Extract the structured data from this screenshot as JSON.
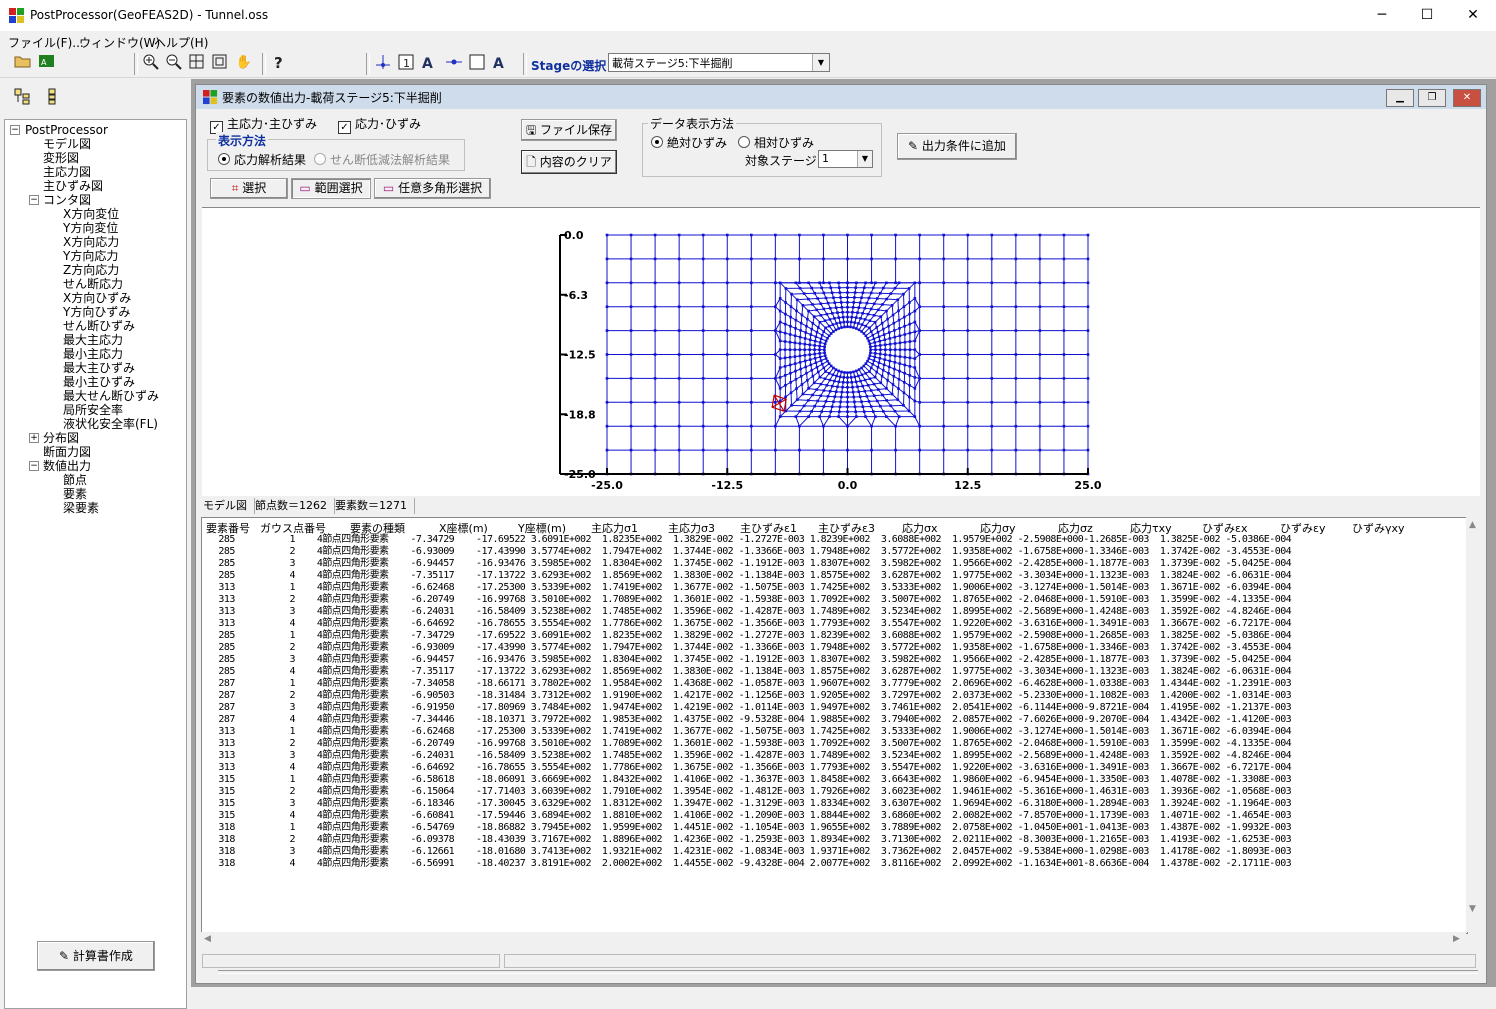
{
  "window": {
    "title": "PostProcessor(GeoFEAS2D) - Tunnel.oss",
    "minimize": "─",
    "maximize": "☐",
    "close": "✕"
  },
  "menu": [
    "ファイル(F)...",
    "ウィンドウ(W)",
    "ヘルプ(H)"
  ],
  "toolbar": {
    "stage_label": "Stageの選択",
    "stage_value": "載荷ステージ5:下半掘削"
  },
  "tree": {
    "root": "PostProcessor",
    "items": [
      "モデル図",
      "変形図",
      "主応力図",
      "主ひずみ図",
      "コンタ図",
      "X方向変位",
      "Y方向変位",
      "X方向応力",
      "Y方向応力",
      "Z方向応力",
      "せん断応力",
      "X方向ひずみ",
      "Y方向ひずみ",
      "せん断ひずみ",
      "最大主応力",
      "最小主応力",
      "最大主ひずみ",
      "最小主ひずみ",
      "最大せん断ひずみ",
      "局所安全率",
      "液状化安全率(FL)",
      "分布図",
      "断面力図",
      "数値出力",
      "節点",
      "要素",
      "梁要素"
    ]
  },
  "calc_button": "計算書作成",
  "child": {
    "title": "要素の数値出力-載荷ステージ5:下半掘削",
    "chk_principal": "主応力･主ひずみ",
    "chk_stress": "応力･ひずみ",
    "display_method": "表示方法",
    "radio_stress": "応力解析結果",
    "radio_shear": "せん断低減法解析結果",
    "btn_save": "ファイル保存",
    "btn_clear": "内容のクリア",
    "data_method": "データ表示方法",
    "radio_abs": "絶対ひずみ",
    "radio_rel": "相対ひずみ",
    "target_stage_label": "対象ステージ",
    "target_stage_value": "1",
    "btn_add": "出力条件に追加",
    "btn_select": "選択",
    "btn_range": "範囲選択",
    "btn_poly": "任意多角形選択"
  },
  "plot": {
    "y_ticks": [
      "0.0",
      "-6.3",
      "-12.5",
      "-18.8",
      "-25.0"
    ],
    "x_ticks": [
      "-25.0",
      "-12.5",
      "0.0",
      "12.5",
      "25.0"
    ]
  },
  "status": {
    "model": "モデル図",
    "nodes": "節点数＝1262",
    "elements": "要素数＝1271"
  },
  "table": {
    "headers": [
      "要素番号",
      "ガウス点番号",
      "要素の種類",
      "X座標(m)",
      "Y座標(m)",
      "主応力σ1",
      "主応力σ3",
      "主ひずみε1",
      "主ひずみε3",
      "応力σx",
      "応力σy",
      "応力σz",
      "応力τxy",
      "ひずみεx",
      "ひずみεy",
      "ひずみγxy"
    ],
    "rows": [
      "   285          1    4節点四角形要素    -7.34729    -17.69522 3.6091E+002  1.8235E+002  1.3829E-002 -1.2727E-003 1.8239E+002  3.6088E+002  1.9579E+002 -2.5908E+000-1.2685E-003  1.3825E-002 -5.0386E-004",
      "   285          2    4節点四角形要素    -6.93009    -17.43990 3.5774E+002  1.7947E+002  1.3744E-002 -1.3366E-003 1.7948E+002  3.5772E+002  1.9358E+002 -1.6758E+000-1.3346E-003  1.3742E-002 -3.4553E-004",
      "   285          3    4節点四角形要素    -6.94457    -16.93476 3.5985E+002  1.8304E+002  1.3745E-002 -1.1912E-003 1.8307E+002  3.5982E+002  1.9566E+002 -2.4285E+000-1.1877E-003  1.3739E-002 -5.0425E-004",
      "   285          4    4節点四角形要素    -7.35117    -17.13722 3.6293E+002  1.8569E+002  1.3830E-002 -1.1384E-003 1.8575E+002  3.6287E+002  1.9775E+002 -3.3034E+000-1.1323E-003  1.3824E-002 -6.0631E-004",
      "   313          1    4節点四角形要素    -6.62468    -17.25300 3.5339E+002  1.7419E+002  1.3677E-002 -1.5075E-003 1.7425E+002  3.5333E+002  1.9006E+002 -3.1274E+000-1.5014E-003  1.3671E-002 -6.0394E-004",
      "   313          2    4節点四角形要素    -6.20749    -16.99768 3.5010E+002  1.7089E+002  1.3601E-002 -1.5938E-003 1.7092E+002  3.5007E+002  1.8765E+002 -2.0468E+000-1.5910E-003  1.3599E-002 -4.1335E-004",
      "   313          3    4節点四角形要素    -6.24031    -16.58409 3.5238E+002  1.7485E+002  1.3596E-002 -1.4287E-003 1.7489E+002  3.5234E+002  1.8995E+002 -2.5689E+000-1.4248E-003  1.3592E-002 -4.8246E-004",
      "   313          4    4節点四角形要素    -6.64692    -16.78655 3.5554E+002  1.7786E+002  1.3675E-002 -1.3566E-003 1.7793E+002  3.5547E+002  1.9220E+002 -3.6316E+000-1.3491E-003  1.3667E-002 -6.7217E-004",
      "   285          1    4節点四角形要素    -7.34729    -17.69522 3.6091E+002  1.8235E+002  1.3829E-002 -1.2727E-003 1.8239E+002  3.6088E+002  1.9579E+002 -2.5908E+000-1.2685E-003  1.3825E-002 -5.0386E-004",
      "   285          2    4節点四角形要素    -6.93009    -17.43990 3.5774E+002  1.7947E+002  1.3744E-002 -1.3366E-003 1.7948E+002  3.5772E+002  1.9358E+002 -1.6758E+000-1.3346E-003  1.3742E-002 -3.4553E-004",
      "   285          3    4節点四角形要素    -6.94457    -16.93476 3.5985E+002  1.8304E+002  1.3745E-002 -1.1912E-003 1.8307E+002  3.5982E+002  1.9566E+002 -2.4285E+000-1.1877E-003  1.3739E-002 -5.0425E-004",
      "   285          4    4節点四角形要素    -7.35117    -17.13722 3.6293E+002  1.8569E+002  1.3830E-002 -1.1384E-003 1.8575E+002  3.6287E+002  1.9775E+002 -3.3034E+000-1.1323E-003  1.3824E-002 -6.0631E-004",
      "   287          1    4節点四角形要素    -7.34058    -18.66171 3.7802E+002  1.9584E+002  1.4368E-002 -1.0587E-003 1.9607E+002  3.7779E+002  2.0696E+002 -6.4628E+000-1.0338E-003  1.4344E-002 -1.2391E-003",
      "   287          2    4節点四角形要素    -6.90503    -18.31484 3.7312E+002  1.9190E+002  1.4217E-002 -1.1256E-003 1.9205E+002  3.7297E+002  2.0373E+002 -5.2330E+000-1.1082E-003  1.4200E-002 -1.0314E-003",
      "   287          3    4節点四角形要素    -6.91950    -17.80969 3.7484E+002  1.9474E+002  1.4219E-002 -1.0114E-003 1.9497E+002  3.7461E+002  2.0541E+002 -6.1144E+000-9.8721E-004  1.4195E-002 -1.2137E-003",
      "   287          4    4節点四角形要素    -7.34446    -18.10371 3.7972E+002  1.9853E+002  1.4375E-002 -9.5328E-004 1.9885E+002  3.7940E+002  2.0857E+002 -7.6026E+000-9.2070E-004  1.4342E-002 -1.4120E-003",
      "   313          1    4節点四角形要素    -6.62468    -17.25300 3.5339E+002  1.7419E+002  1.3677E-002 -1.5075E-003 1.7425E+002  3.5333E+002  1.9006E+002 -3.1274E+000-1.5014E-003  1.3671E-002 -6.0394E-004",
      "   313          2    4節点四角形要素    -6.20749    -16.99768 3.5010E+002  1.7089E+002  1.3601E-002 -1.5938E-003 1.7092E+002  3.5007E+002  1.8765E+002 -2.0468E+000-1.5910E-003  1.3599E-002 -4.1335E-004",
      "   313          3    4節点四角形要素    -6.24031    -16.58409 3.5238E+002  1.7485E+002  1.3596E-002 -1.4287E-003 1.7489E+002  3.5234E+002  1.8995E+002 -2.5689E+000-1.4248E-003  1.3592E-002 -4.8246E-004",
      "   313          4    4節点四角形要素    -6.64692    -16.78655 3.5554E+002  1.7786E+002  1.3675E-002 -1.3566E-003 1.7793E+002  3.5547E+002  1.9220E+002 -3.6316E+000-1.3491E-003  1.3667E-002 -6.7217E-004",
      "   315          1    4節点四角形要素    -6.58618    -18.06091 3.6669E+002  1.8432E+002  1.4106E-002 -1.3637E-003 1.8458E+002  3.6643E+002  1.9860E+002 -6.9454E+000-1.3350E-003  1.4078E-002 -1.3308E-003",
      "   315          2    4節点四角形要素    -6.15064    -17.71403 3.6039E+002  1.7910E+002  1.3954E-002 -1.4812E-003 1.7926E+002  3.6023E+002  1.9461E+002 -5.3616E+000-1.4631E-003  1.3936E-002 -1.0568E-003",
      "   315          3    4節点四角形要素    -6.18346    -17.30045 3.6329E+002  1.8312E+002  1.3947E-002 -1.3129E-003 1.8334E+002  3.6307E+002  1.9694E+002 -6.3180E+000-1.2894E-003  1.3924E-002 -1.1964E-003",
      "   315          4    4節点四角形要素    -6.60841    -17.59446 3.6894E+002  1.8810E+002  1.4106E-002 -1.2090E-003 1.8844E+002  3.6860E+002  2.0082E+002 -7.8570E+000-1.1739E-003  1.4071E-002 -1.4654E-003",
      "   318          1    4節点四角形要素    -6.54769    -18.86882 3.7945E+002  1.9599E+002  1.4451E-002 -1.1054E-003 1.9655E+002  3.7889E+002  2.0758E+002 -1.0450E+001-1.0413E-003  1.4387E-002 -1.9932E-003",
      "   318          2    4節点四角形要素    -6.09378    -18.43039 3.7167E+002  1.8896E+002  1.4236E-002 -1.2593E-003 1.8934E+002  3.7130E+002  2.0211E+002 -8.3003E+000-1.2165E-003  1.4193E-002 -1.6253E-003",
      "   318          3    4節点四角形要素    -6.12661    -18.01680 3.7413E+002  1.9321E+002  1.4231E-002 -1.0834E-003 1.9371E+002  3.7362E+002  2.0457E+002 -9.5384E+000-1.0298E-003  1.4178E-002 -1.8093E-003",
      "   318          4    4節点四角形要素    -6.56991    -18.40237 3.8191E+002  2.0002E+002  1.4455E-002 -9.4328E-004 2.0077E+002  3.8116E+002  2.0992E+002 -1.1634E+001-8.6636E-004  1.4378E-002 -2.1711E-003"
    ]
  }
}
